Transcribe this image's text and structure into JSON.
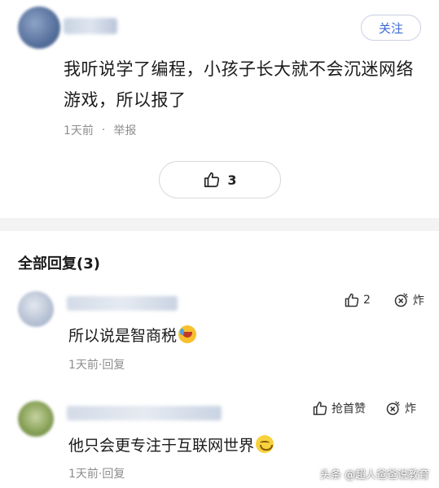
{
  "post": {
    "follow_label": "关注",
    "text": "我听说学了编程，小孩子长大就不会沉迷网络游戏，所以报了",
    "time": "1天前",
    "separator": "·",
    "report_label": "举报",
    "like_count": "3"
  },
  "replies_header": "全部回复(3)",
  "replies": [
    {
      "text": "所以说是智商税",
      "emoji": "laugh-crying-emoji",
      "time": "1天前",
      "reply_label": "回复",
      "like_label": "2",
      "bomb_label": "炸"
    },
    {
      "text": "他只会更专注于互联网世界",
      "emoji": "smile-emoji",
      "time": "1天前",
      "reply_label": "回复",
      "like_label": "抢首赞",
      "bomb_label": "炸"
    }
  ],
  "watermark": "头条 @超人爸爸说教育",
  "colors": {
    "accent": "#3c6bd6",
    "muted": "#8d8d8d",
    "band": "#f3f3f3"
  }
}
